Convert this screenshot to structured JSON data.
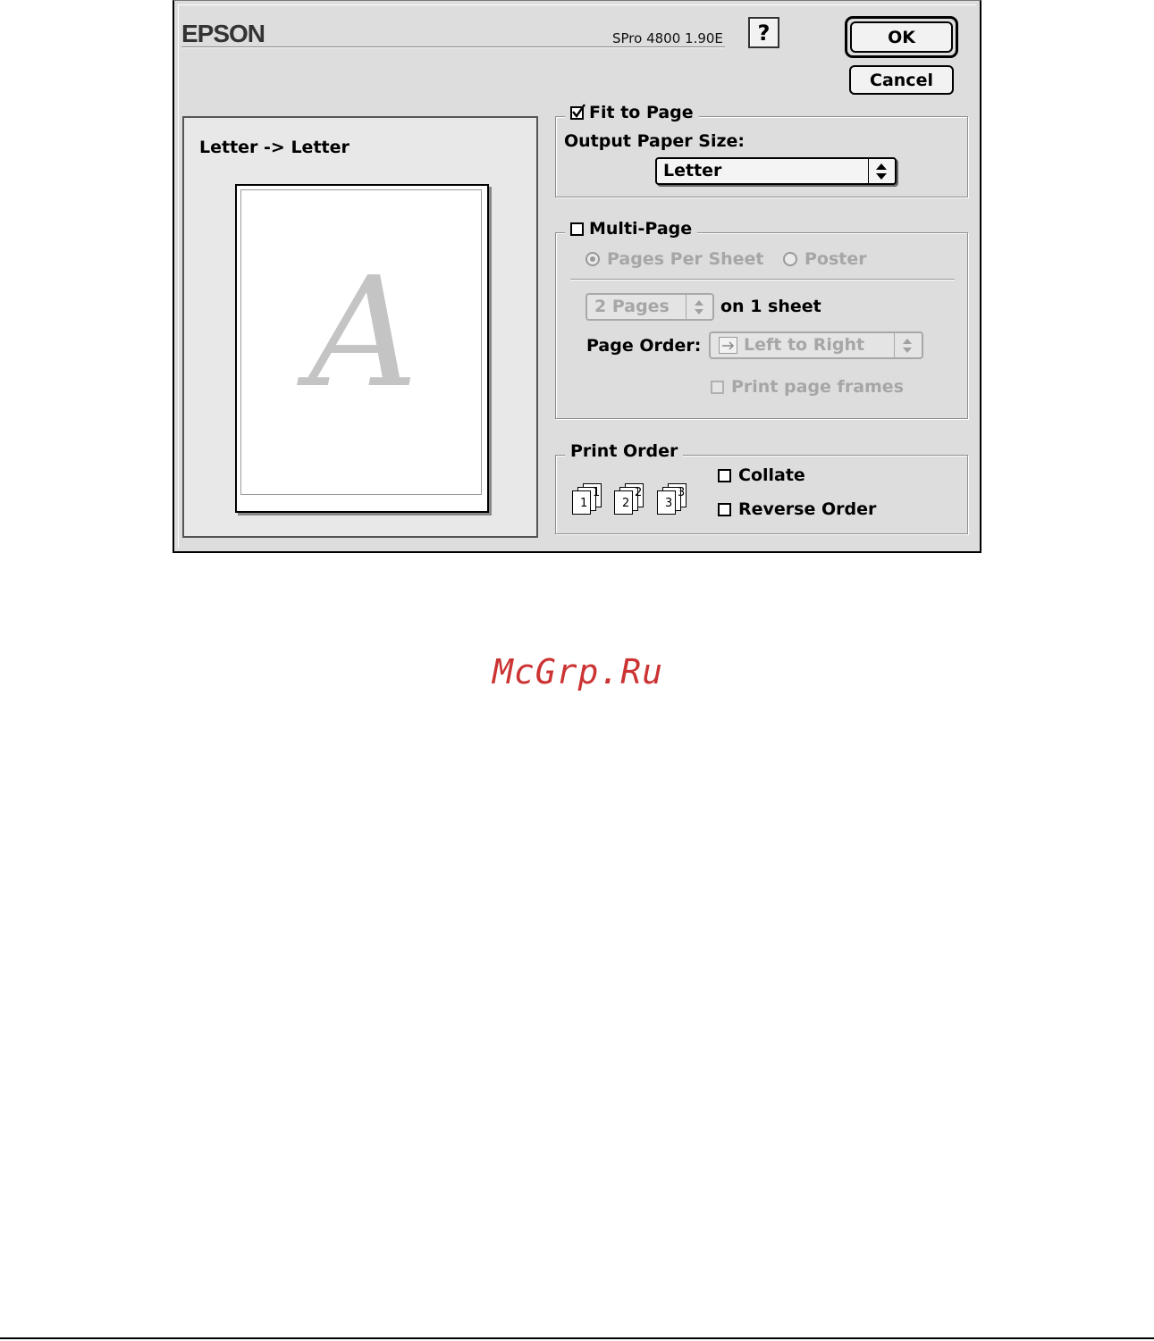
{
  "header": {
    "brand": "EPSON",
    "version": "SPro 4800 1.90E",
    "help_label": "?"
  },
  "buttons": {
    "ok": "OK",
    "cancel": "Cancel"
  },
  "preview": {
    "paper_mapping": "Letter -> Letter",
    "sample_letter": "A"
  },
  "fit_to_page": {
    "label": "Fit to Page",
    "checked": true,
    "output_paper_size_label": "Output Paper Size:",
    "output_paper_size_value": "Letter"
  },
  "multi_page": {
    "label": "Multi-Page",
    "checked": false,
    "options": [
      "Pages Per Sheet",
      "Poster"
    ],
    "selected_option": "Pages Per Sheet",
    "pages_value": "2 Pages",
    "pages_suffix": "on 1 sheet",
    "page_order_label": "Page Order:",
    "page_order_value": "Left to Right",
    "print_page_frames_label": "Print page frames",
    "print_page_frames_checked": false
  },
  "print_order": {
    "label": "Print Order",
    "icon_numbers": [
      "1",
      "2",
      "3"
    ],
    "collate_label": "Collate",
    "collate_checked": false,
    "reverse_order_label": "Reverse Order",
    "reverse_order_checked": false
  },
  "watermark": {
    "text": "McGrp.Ru",
    "color": "#cc3333"
  }
}
